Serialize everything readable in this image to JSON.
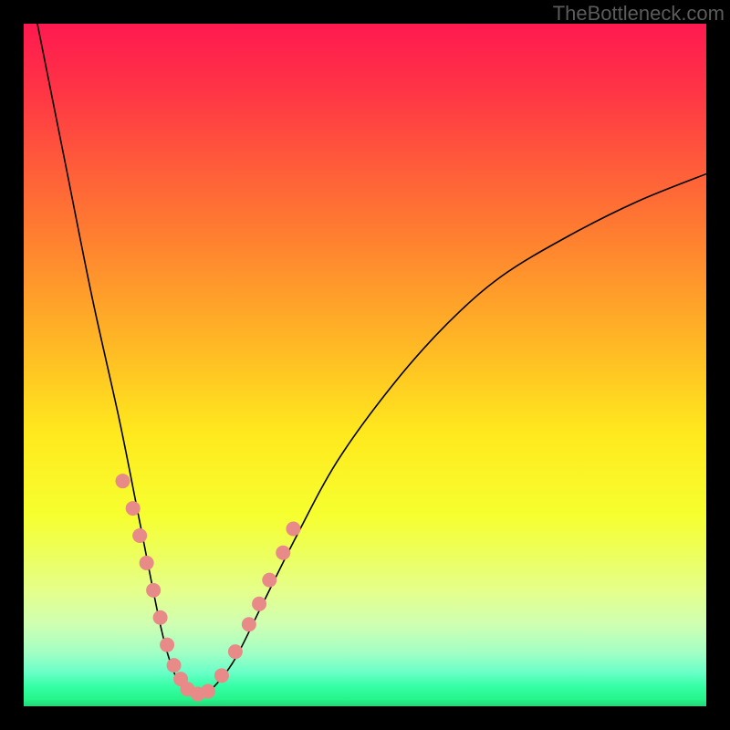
{
  "watermark": "TheBottleneck.com",
  "chart_data": {
    "type": "line",
    "title": "",
    "xlabel": "",
    "ylabel": "",
    "x_range": [
      0,
      100
    ],
    "y_range": [
      0,
      100
    ],
    "series": [
      {
        "name": "curve",
        "type": "spline",
        "points": [
          [
            2,
            100
          ],
          [
            6,
            80
          ],
          [
            10,
            60
          ],
          [
            14,
            42
          ],
          [
            17,
            27
          ],
          [
            20,
            12
          ],
          [
            22,
            5
          ],
          [
            24,
            2
          ],
          [
            26,
            1.5
          ],
          [
            28,
            3
          ],
          [
            31,
            7
          ],
          [
            35,
            15
          ],
          [
            40,
            25
          ],
          [
            46,
            36
          ],
          [
            54,
            47
          ],
          [
            62,
            56
          ],
          [
            70,
            63
          ],
          [
            80,
            69
          ],
          [
            90,
            74
          ],
          [
            100,
            78
          ]
        ]
      }
    ],
    "data_points": [
      {
        "x": 14.5,
        "y": 33
      },
      {
        "x": 16,
        "y": 29
      },
      {
        "x": 17,
        "y": 25
      },
      {
        "x": 18,
        "y": 21
      },
      {
        "x": 19,
        "y": 17
      },
      {
        "x": 20,
        "y": 13
      },
      {
        "x": 21,
        "y": 9
      },
      {
        "x": 22,
        "y": 6
      },
      {
        "x": 23,
        "y": 4
      },
      {
        "x": 24,
        "y": 2.5
      },
      {
        "x": 25.5,
        "y": 1.8
      },
      {
        "x": 27,
        "y": 2.2
      },
      {
        "x": 29,
        "y": 4.5
      },
      {
        "x": 31,
        "y": 8
      },
      {
        "x": 33,
        "y": 12
      },
      {
        "x": 34.5,
        "y": 15
      },
      {
        "x": 36,
        "y": 18.5
      },
      {
        "x": 38,
        "y": 22.5
      },
      {
        "x": 39.5,
        "y": 26
      }
    ],
    "point_radius": 8,
    "point_color": "#e88a87",
    "gradient_bg": true,
    "outer_bg": "#000000"
  }
}
